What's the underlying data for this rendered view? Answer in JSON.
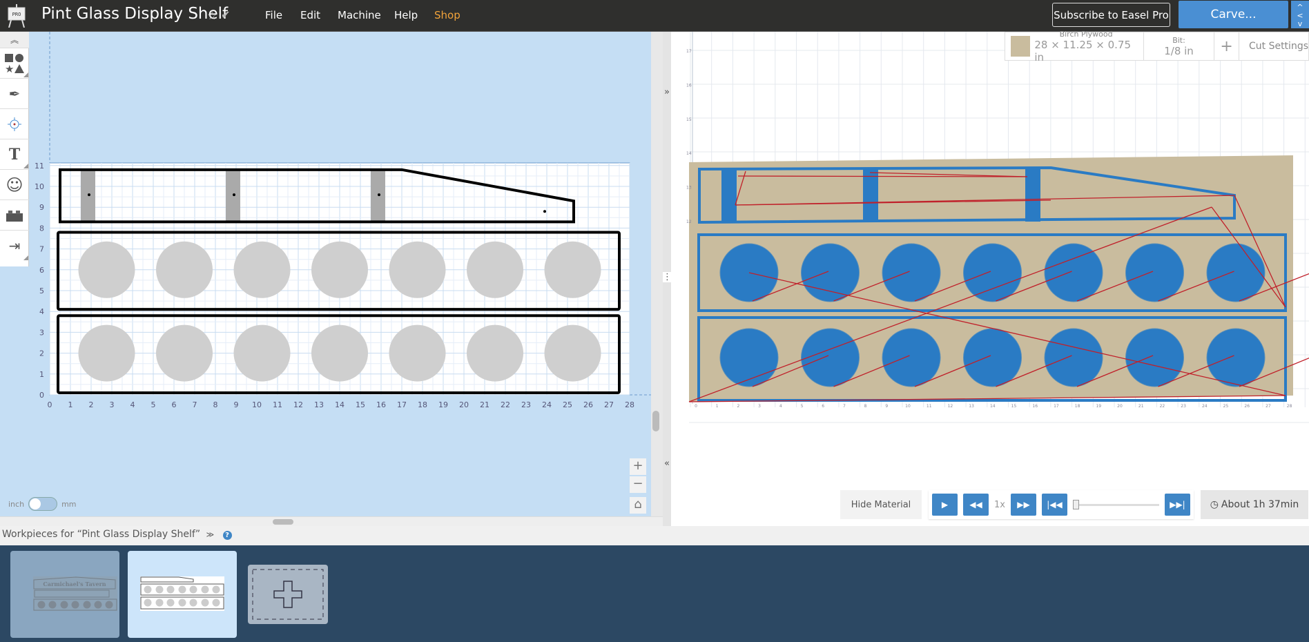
{
  "app": {
    "title": "Pint Glass Display Shelf",
    "logo_text": "PRO",
    "star_icon": "star-icon",
    "saved_icon": "check-icon"
  },
  "menu": [
    {
      "label": "File"
    },
    {
      "label": "Edit"
    },
    {
      "label": "Machine"
    },
    {
      "label": "Help"
    },
    {
      "label": "Shop",
      "color": "#f2a33a"
    }
  ],
  "header": {
    "subscribe_label": "Subscribe to Easel Pro",
    "carve_label": "Carve...",
    "accent": "#4a8fd3"
  },
  "toolbar": [
    "shapes-icon",
    "pen-icon",
    "target-icon",
    "text-icon",
    "smiley-icon",
    "lego-icon",
    "import-icon"
  ],
  "design": {
    "x_ticks": [
      "0",
      "1",
      "2",
      "3",
      "4",
      "5",
      "6",
      "7",
      "8",
      "9",
      "10",
      "11",
      "12",
      "13",
      "14",
      "15",
      "16",
      "17",
      "18",
      "19",
      "20",
      "21",
      "22",
      "23",
      "24",
      "25",
      "26",
      "27",
      "28"
    ],
    "y_ticks": [
      "0",
      "1",
      "2",
      "3",
      "4",
      "5",
      "6",
      "7",
      "8",
      "9",
      "10",
      "11"
    ]
  },
  "units": {
    "left": "inch",
    "right": "mm",
    "selected": "inch"
  },
  "zoom": {
    "in": "+",
    "out": "−",
    "home": "⌂"
  },
  "material": {
    "name": "Birch Plywood",
    "dims": "28 × 11.25 × 0.75 in",
    "bit_label": "Bit:",
    "bit_value": "1/8 in",
    "add": "+",
    "cut_settings": "Cut Settings",
    "swatch": "#c9bc9e"
  },
  "preview": {
    "x_ticks": [
      "0",
      "1",
      "2",
      "3",
      "4",
      "5",
      "6",
      "7",
      "8",
      "9",
      "10",
      "11",
      "12",
      "13",
      "14",
      "15",
      "16",
      "17",
      "18",
      "19",
      "20",
      "21",
      "22",
      "23",
      "24",
      "25",
      "26",
      "27",
      "28"
    ],
    "y_ticks": [
      "17",
      "16",
      "15",
      "14",
      "13",
      "12"
    ],
    "cut_color": "#2a7bc4",
    "path_color": "#c0202a"
  },
  "playback": {
    "hide_material": "Hide Material",
    "speed": "1x",
    "progress": 0,
    "estimate": "About 1h 37min"
  },
  "dividers": {
    "expand": "»",
    "handle": "⋮",
    "collapse": "«"
  },
  "workpieces": {
    "title": "Workpieces for “Pint Glass Display Shelf”",
    "expand_icon": "≫",
    "help": "?",
    "thumb_text": "Carmichael's Tavern"
  }
}
